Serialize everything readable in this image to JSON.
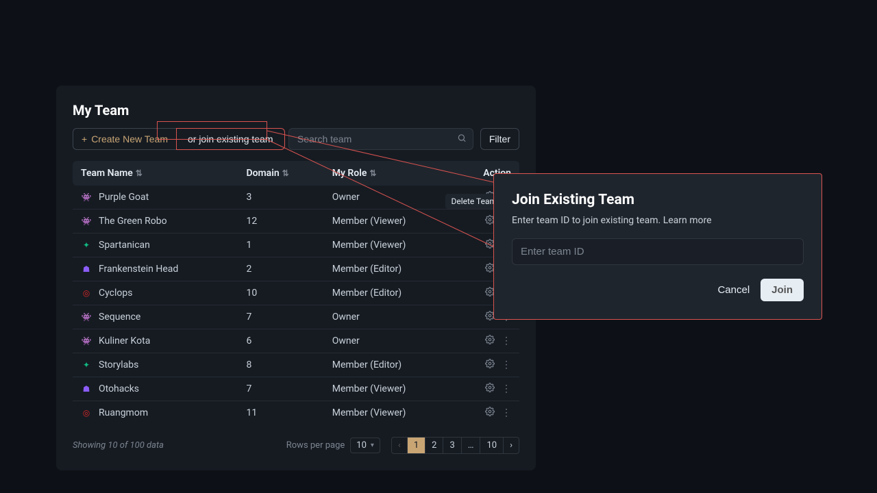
{
  "page": {
    "title": "My Team"
  },
  "toolbar": {
    "create_label": "Create New Team",
    "join_label": "or join existing team",
    "search_placeholder": "Search team",
    "filter_label": "Filter"
  },
  "columns": {
    "name": "Team Name",
    "domain": "Domain",
    "role": "My Role",
    "action": "Action"
  },
  "tooltip": {
    "delete": "Delete Team"
  },
  "teams": [
    {
      "icon": "👾",
      "color": "#8b5cf6",
      "name": "Purple Goat",
      "domain": "3",
      "role": "Owner"
    },
    {
      "icon": "👾",
      "color": "#d97706",
      "name": "The Green Robo",
      "domain": "12",
      "role": "Member (Viewer)"
    },
    {
      "icon": "✦",
      "color": "#10b981",
      "name": "Spartanican",
      "domain": "1",
      "role": "Member (Viewer)"
    },
    {
      "icon": "☗",
      "color": "#8b5cf6",
      "name": "Frankenstein Head",
      "domain": "2",
      "role": "Member (Editor)"
    },
    {
      "icon": "◎",
      "color": "#dc2626",
      "name": "Cyclops",
      "domain": "10",
      "role": "Member (Editor)"
    },
    {
      "icon": "👾",
      "color": "#8b5cf6",
      "name": "Sequence",
      "domain": "7",
      "role": "Owner"
    },
    {
      "icon": "👾",
      "color": "#d97706",
      "name": "Kuliner Kota",
      "domain": "6",
      "role": "Owner"
    },
    {
      "icon": "✦",
      "color": "#10b981",
      "name": "Storylabs",
      "domain": "8",
      "role": "Member (Editor)"
    },
    {
      "icon": "☗",
      "color": "#8b5cf6",
      "name": "Otohacks",
      "domain": "7",
      "role": "Member (Viewer)"
    },
    {
      "icon": "◎",
      "color": "#dc2626",
      "name": "Ruangmom",
      "domain": "11",
      "role": "Member (Viewer)"
    }
  ],
  "footer": {
    "info": "Showing 10 of 100 data",
    "rows_label": "Rows per page",
    "rows_value": "10",
    "pages": [
      "1",
      "2",
      "3",
      "…",
      "10"
    ],
    "active_page": "1"
  },
  "modal": {
    "title": "Join Existing Team",
    "desc": "Enter team ID to join existing team. Learn more",
    "placeholder": "Enter team ID",
    "cancel": "Cancel",
    "join": "Join"
  }
}
